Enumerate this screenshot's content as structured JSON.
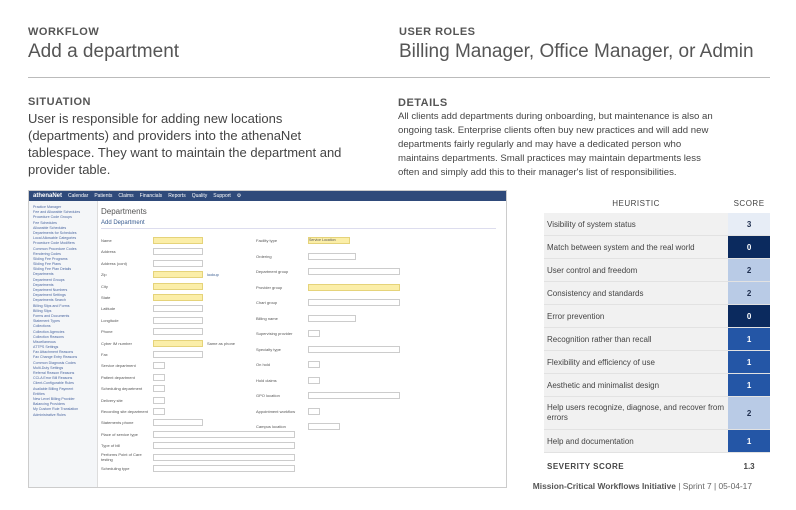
{
  "workflow": {
    "label": "WORKFLOW",
    "title": "Add a department"
  },
  "roles": {
    "label": "USER ROLES",
    "title": "Billing Manager, Office Manager, or Admin"
  },
  "situation": {
    "label": "SITUATION",
    "lines": [
      "User is responsible for adding new locations",
      "(departments) and providers into the athenaNet",
      "tablespace. They want to maintain the department and",
      "provider table."
    ]
  },
  "details": {
    "label": "DETAILS",
    "lines": [
      "All clients add departments during onboarding, but maintenance is also an",
      "ongoing task. Enterprise clients often buy new practices and will add new",
      "departments fairly regularly and may have a dedicated person who",
      "maintains departments. Small practices may maintain departments less",
      "often and simply add this to their manager's list of responsibilities."
    ]
  },
  "screenshot": {
    "app_name": "athenaNet",
    "nav": [
      "Calendar",
      "Patients",
      "Claims",
      "Financials",
      "Reports",
      "Quality",
      "Support"
    ],
    "page_title": "Departments",
    "section_title": "Add Department",
    "left_fields": [
      "Name",
      "Address",
      "Address (cont)",
      "Zip",
      "City",
      "State",
      "Latitude",
      "Longitude",
      "Phone",
      "Cyber IM number",
      "Fax",
      "Service department",
      "Patient department",
      "Scheduling department",
      "Delivery site",
      "Recording site department",
      "Statements phone",
      "Place of service type",
      "Type of bill",
      "Performs Point of Care testing",
      "Scheduling type"
    ],
    "right_fields": [
      "Facility type",
      "Ordering",
      "Department group",
      "Provider group",
      "Chart group",
      "Billing name",
      "Supervising provider",
      "Specialty type",
      "On hold",
      "Hold claims",
      "GPO location",
      "Appointment workflow",
      "Campus location"
    ],
    "zip_lookup": "lookup",
    "same_as_phone": "Same as phone",
    "facility_value": "Service Location",
    "sidebar_items": [
      "Practice Manager",
      "Fee and Allowable Schedules",
      "Procedure Code Groups",
      "Fee Schedules",
      "Allowable Schedules",
      "Departments for Schedules",
      "Local Allowable Categories",
      "Procedure Code Modifiers",
      "Common Procedure Codes",
      "Rendering Codes",
      "Sliding Fee Programs",
      "Sliding Fee Plans",
      "Sliding Fee Plan Details",
      "Departments",
      "Department Groups",
      "Departments",
      "Department Numbers",
      "Department Settings",
      "Departments Search",
      "Billing Slips and Forms",
      "Billing Slips",
      "Forms and Documents",
      "Statement Types",
      "Collections",
      "Collection Agencies",
      "Collection Reasons",
      "Miscellaneous",
      "ATTPS Settings",
      "Fax Attachment Reasons",
      "Fax Change Entry Reasons",
      "Common Diagnosis Codes",
      "Multi-Duty Settings",
      "Referral Reason Reasons",
      "CCLA Error Bill Reasons",
      "Client-Configurable Rules",
      "Available Billing Payment",
      "Entities",
      "New Level Billing Provider",
      "Balancing Providers",
      "My Custom Rule Translation",
      "Administrative Rules"
    ]
  },
  "heuristics": {
    "header_heuristic": "HEURISTIC",
    "header_score": "SCORE",
    "rows": [
      {
        "name": "Visibility of system status",
        "score": "3"
      },
      {
        "name": "Match between system and the real world",
        "score": "0"
      },
      {
        "name": "User control and freedom",
        "score": "2"
      },
      {
        "name": "Consistency and standards",
        "score": "2"
      },
      {
        "name": "Error prevention",
        "score": "0"
      },
      {
        "name": "Recognition rather than recall",
        "score": "1"
      },
      {
        "name": "Flexibility and efficiency of use",
        "score": "1"
      },
      {
        "name": "Aesthetic and minimalist design",
        "score": "1"
      },
      {
        "name": "Help users recognize, diagnose, and recover from errors",
        "score": "2"
      },
      {
        "name": "Help and documentation",
        "score": "1"
      }
    ],
    "severity_label": "SEVERITY SCORE",
    "severity_value": "1.3",
    "score_colors": {
      "0": "#0b2a5e",
      "1": "#2456a6",
      "2": "#b9cbe6",
      "3": "#e7edf6"
    },
    "score_text_colors": {
      "0": "#ffffff",
      "1": "#ffffff",
      "2": "#1f2f4f",
      "3": "#1f2f4f"
    }
  },
  "footer": {
    "initiative": "Mission-Critical Workflows Initiative",
    "meta": " | Sprint 7 | 05-04-17"
  }
}
